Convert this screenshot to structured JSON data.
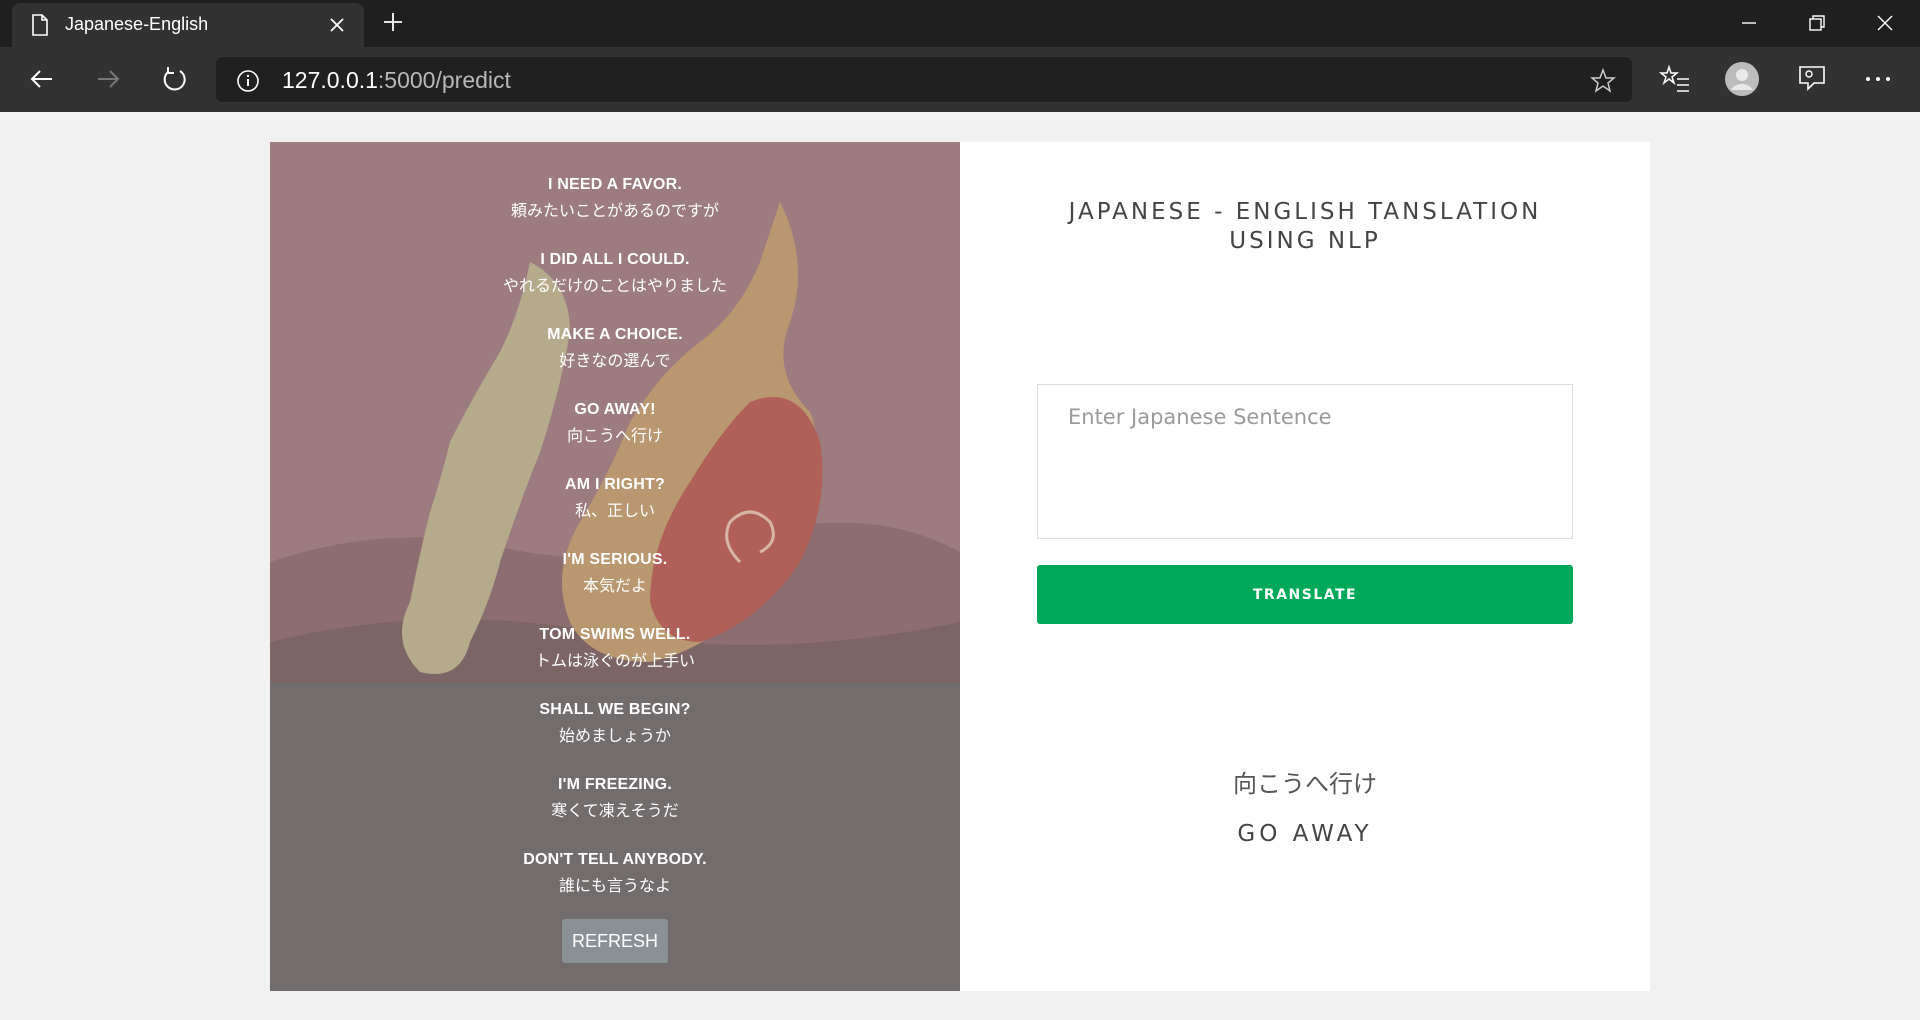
{
  "browser": {
    "tab_title": "Japanese-English",
    "url_host": "127.0.0.1",
    "url_rest": ":5000/predict"
  },
  "left_panel": {
    "phrases": [
      {
        "en": "I NEED A FAVOR.",
        "ja": "頼みたいことがあるのですが"
      },
      {
        "en": "I DID ALL I COULD.",
        "ja": "やれるだけのことはやりました"
      },
      {
        "en": "MAKE A CHOICE.",
        "ja": "好きなの選んで"
      },
      {
        "en": "GO AWAY!",
        "ja": "向こうへ行け"
      },
      {
        "en": "AM I RIGHT?",
        "ja": "私、正しい"
      },
      {
        "en": "I'M SERIOUS.",
        "ja": "本気だよ"
      },
      {
        "en": "TOM SWIMS WELL.",
        "ja": "トムは泳ぐのが上手い"
      },
      {
        "en": "SHALL WE BEGIN?",
        "ja": "始めましょうか"
      },
      {
        "en": "I'M FREEZING.",
        "ja": "寒くて凍えそうだ"
      },
      {
        "en": "DON'T TELL ANYBODY.",
        "ja": "誰にも言うなよ"
      }
    ],
    "refresh_label": "REFRESH"
  },
  "right_panel": {
    "heading_line1": "JAPANESE - ENGLISH TANSLATION",
    "heading_line2": "USING NLP",
    "input_placeholder": "Enter Japanese Sentence",
    "input_value": "",
    "translate_label": "TRANSLATE",
    "result_ja": "向こうへ行け",
    "result_en": "GO AWAY"
  },
  "colors": {
    "translate_button": "#00a85a",
    "refresh_button": "#8a9196",
    "left_panel_bg": "#6f6868"
  }
}
